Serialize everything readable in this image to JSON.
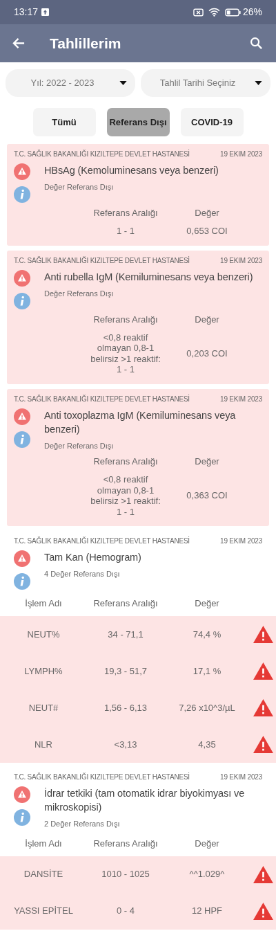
{
  "status_bar": {
    "time": "13:17",
    "battery": "26%"
  },
  "app_bar": {
    "title": "Tahlillerim"
  },
  "filters": [
    {
      "label": "Yıl: 2022 - 2023"
    },
    {
      "label": "Tahlil Tarihi Seçiniz"
    }
  ],
  "tabs": [
    {
      "label": "Tümü",
      "selected": false
    },
    {
      "label": "Referans Dışı",
      "selected": true
    },
    {
      "label": "COVID-19",
      "selected": false
    }
  ],
  "results": [
    {
      "kind": "single",
      "hospital": "T.C. SAĞLIK BAKANLIĞI KIZILTEPE DEVLET HASTANESİ",
      "date": "19 EKIM 2023",
      "name": "HBsAg (Kemoluminesans veya benzeri)",
      "status": "Değer Referans Dışı",
      "columns": [
        "Referans Aralığı",
        "Değer"
      ],
      "reference": "1 - 1",
      "value": "0,653 COI"
    },
    {
      "kind": "single",
      "hospital": "T.C. SAĞLIK BAKANLIĞI KIZILTEPE DEVLET HASTANESİ",
      "date": "19 EKIM 2023",
      "name": "Anti rubella IgM (Kemiluminesans veya benzeri)",
      "status": "Değer Referans Dışı",
      "columns": [
        "Referans Aralığı",
        "Değer"
      ],
      "reference": "<0,8 reaktif olmayan 0,8-1 belirsiz >1 reaktif:\n1 - 1",
      "value": "0,203 COI"
    },
    {
      "kind": "single",
      "hospital": "T.C. SAĞLIK BAKANLIĞI KIZILTEPE DEVLET HASTANESİ",
      "date": "19 EKIM 2023",
      "name": "Anti toxoplazma IgM (Kemiluminesans veya benzeri)",
      "status": "Değer Referans Dışı",
      "columns": [
        "Referans Aralığı",
        "Değer"
      ],
      "reference": "<0,8 reaktif olmayan 0,8-1 belirsiz >1 reaktif:\n1 - 1",
      "value": "0,363 COI"
    },
    {
      "kind": "panel",
      "hospital": "T.C. SAĞLIK BAKANLIĞI KIZILTEPE DEVLET HASTANESİ",
      "date": "19 EKIM 2023",
      "name": "Tam Kan (Hemogram)",
      "status": "4 Değer Referans Dışı",
      "columns": [
        "İşlem Adı",
        "Referans Aralığı",
        "Değer"
      ],
      "rows": [
        {
          "name": "NEUT%",
          "reference": "34 - 71,1",
          "value": "74,4 %",
          "out_of_range": true
        },
        {
          "name": "LYMPH%",
          "reference": "19,3 - 51,7",
          "value": "17,1 %",
          "out_of_range": true
        },
        {
          "name": "NEUT#",
          "reference": "1,56 - 6,13",
          "value": "7,26 x10^3/µL",
          "out_of_range": true
        },
        {
          "name": "NLR",
          "reference": "<3,13",
          "value": "4,35",
          "out_of_range": true
        }
      ]
    },
    {
      "kind": "panel",
      "hospital": "T.C. SAĞLIK BAKANLIĞI KIZILTEPE DEVLET HASTANESİ",
      "date": "19 EKIM 2023",
      "name": "İdrar tetkiki (tam otomatik idrar biyokimyası ve mikroskopisi)",
      "status": "2 Değer Referans Dışı",
      "columns": [
        "İşlem Adı",
        "Referans Aralığı",
        "Değer"
      ],
      "rows": [
        {
          "name": "DANSİTE",
          "reference": "1010 - 1025",
          "value": "^^1.029^",
          "out_of_range": true
        },
        {
          "name": "YASSI EPİTEL",
          "reference": "0 - 4",
          "value": "12 HPF",
          "out_of_range": true
        }
      ]
    }
  ]
}
